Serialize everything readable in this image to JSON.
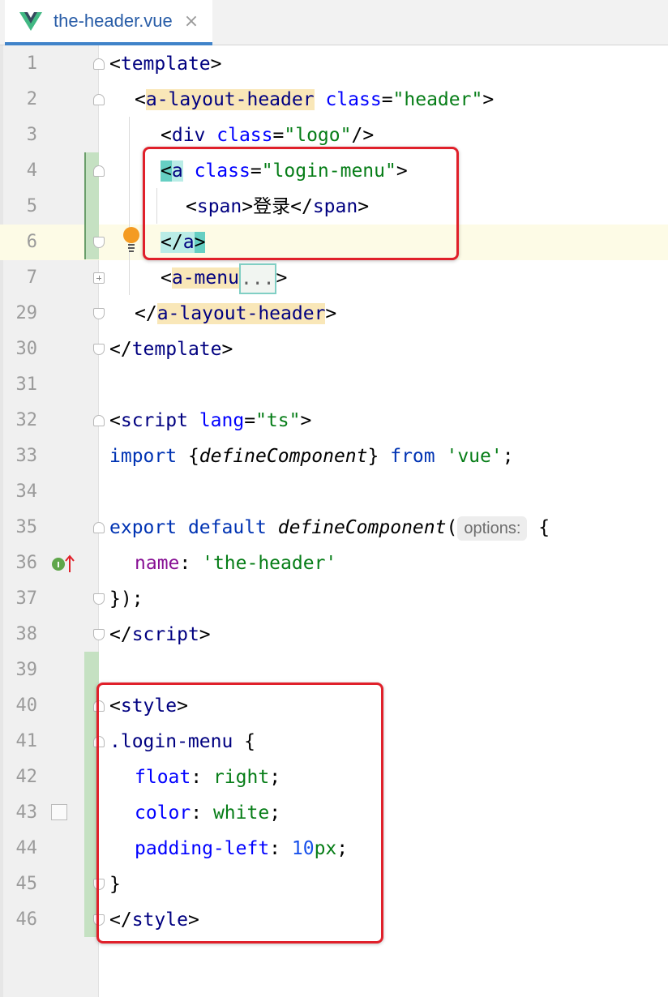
{
  "tab": {
    "label": "the-header.vue",
    "close": "×",
    "icon": "vue-logo-icon"
  },
  "colors": {
    "tag": "#000080",
    "attribute": "#0000ff",
    "string": "#067d17",
    "keyword": "#0033b3",
    "highlight": "#e0202a",
    "vcs_added": "#c5e1c2"
  },
  "lines": [
    {
      "n": "1"
    },
    {
      "n": "2"
    },
    {
      "n": "3"
    },
    {
      "n": "4"
    },
    {
      "n": "5"
    },
    {
      "n": "6"
    },
    {
      "n": "7"
    },
    {
      "n": "29"
    },
    {
      "n": "30"
    },
    {
      "n": "31"
    },
    {
      "n": "32"
    },
    {
      "n": "33"
    },
    {
      "n": "34"
    },
    {
      "n": "35"
    },
    {
      "n": "36"
    },
    {
      "n": "37"
    },
    {
      "n": "38"
    },
    {
      "n": "39"
    },
    {
      "n": "40"
    },
    {
      "n": "41"
    },
    {
      "n": "42"
    },
    {
      "n": "43"
    },
    {
      "n": "44"
    },
    {
      "n": "45"
    },
    {
      "n": "46"
    }
  ],
  "code": {
    "l1": {
      "lt": "<",
      "tag": "template",
      "gt": ">"
    },
    "l2": {
      "lt": "<",
      "tag": "a-layout-header",
      "attr": "class",
      "eq": "=",
      "val": "\"header\"",
      "gt": ">"
    },
    "l3": {
      "lt": "<",
      "tag": "div",
      "attr": "class",
      "eq": "=",
      "val": "\"logo\"",
      "end": "/>"
    },
    "l4": {
      "lt": "<",
      "tag": "a",
      "attr": "class",
      "eq": "=",
      "val": "\"login-menu\"",
      "gt": ">"
    },
    "l5": {
      "open_lt": "<",
      "open_tag": "span",
      "open_gt": ">",
      "text": "登录",
      "close_lt": "</",
      "close_tag": "span",
      "close_gt": ">"
    },
    "l6": {
      "lt": "</",
      "tag": "a",
      "gt": ">"
    },
    "l7": {
      "lt": "<",
      "tag": "a-menu",
      "fold": "...",
      "gt": ">"
    },
    "l29": {
      "lt": "</",
      "tag": "a-layout-header",
      "gt": ">"
    },
    "l30": {
      "lt": "</",
      "tag": "template",
      "gt": ">"
    },
    "l32": {
      "lt": "<",
      "tag": "script",
      "attr": "lang",
      "eq": "=",
      "val": "\"ts\"",
      "gt": ">"
    },
    "l33": {
      "kw": "import",
      "brace_open": " {",
      "fn": "defineComponent",
      "brace_close": "} ",
      "kw2": "from",
      "str": "'vue'",
      "semi": ";"
    },
    "l35": {
      "kw": "export",
      "kw2": "default",
      "fn": "defineComponent",
      "paren": "(",
      "hint": "options:",
      "brace": "{"
    },
    "l36": {
      "prop": "name",
      "colon": ": ",
      "str": "'the-header'"
    },
    "l37": {
      "text": "});"
    },
    "l38": {
      "lt": "</",
      "tag": "script",
      "gt": ">"
    },
    "l40": {
      "lt": "<",
      "tag": "style",
      "gt": ">"
    },
    "l41": {
      "selector": ".login-menu",
      "brace": " {"
    },
    "l42": {
      "prop": "float",
      "colon": ": ",
      "val": "right",
      "semi": ";"
    },
    "l43": {
      "prop": "color",
      "colon": ": ",
      "val": "white",
      "semi": ";"
    },
    "l44": {
      "prop": "padding-left",
      "colon": ": ",
      "num": "10",
      "unit": "px",
      "semi": ";"
    },
    "l45": {
      "text": "}"
    },
    "l46": {
      "lt": "</",
      "tag": "style",
      "gt": ">"
    }
  }
}
